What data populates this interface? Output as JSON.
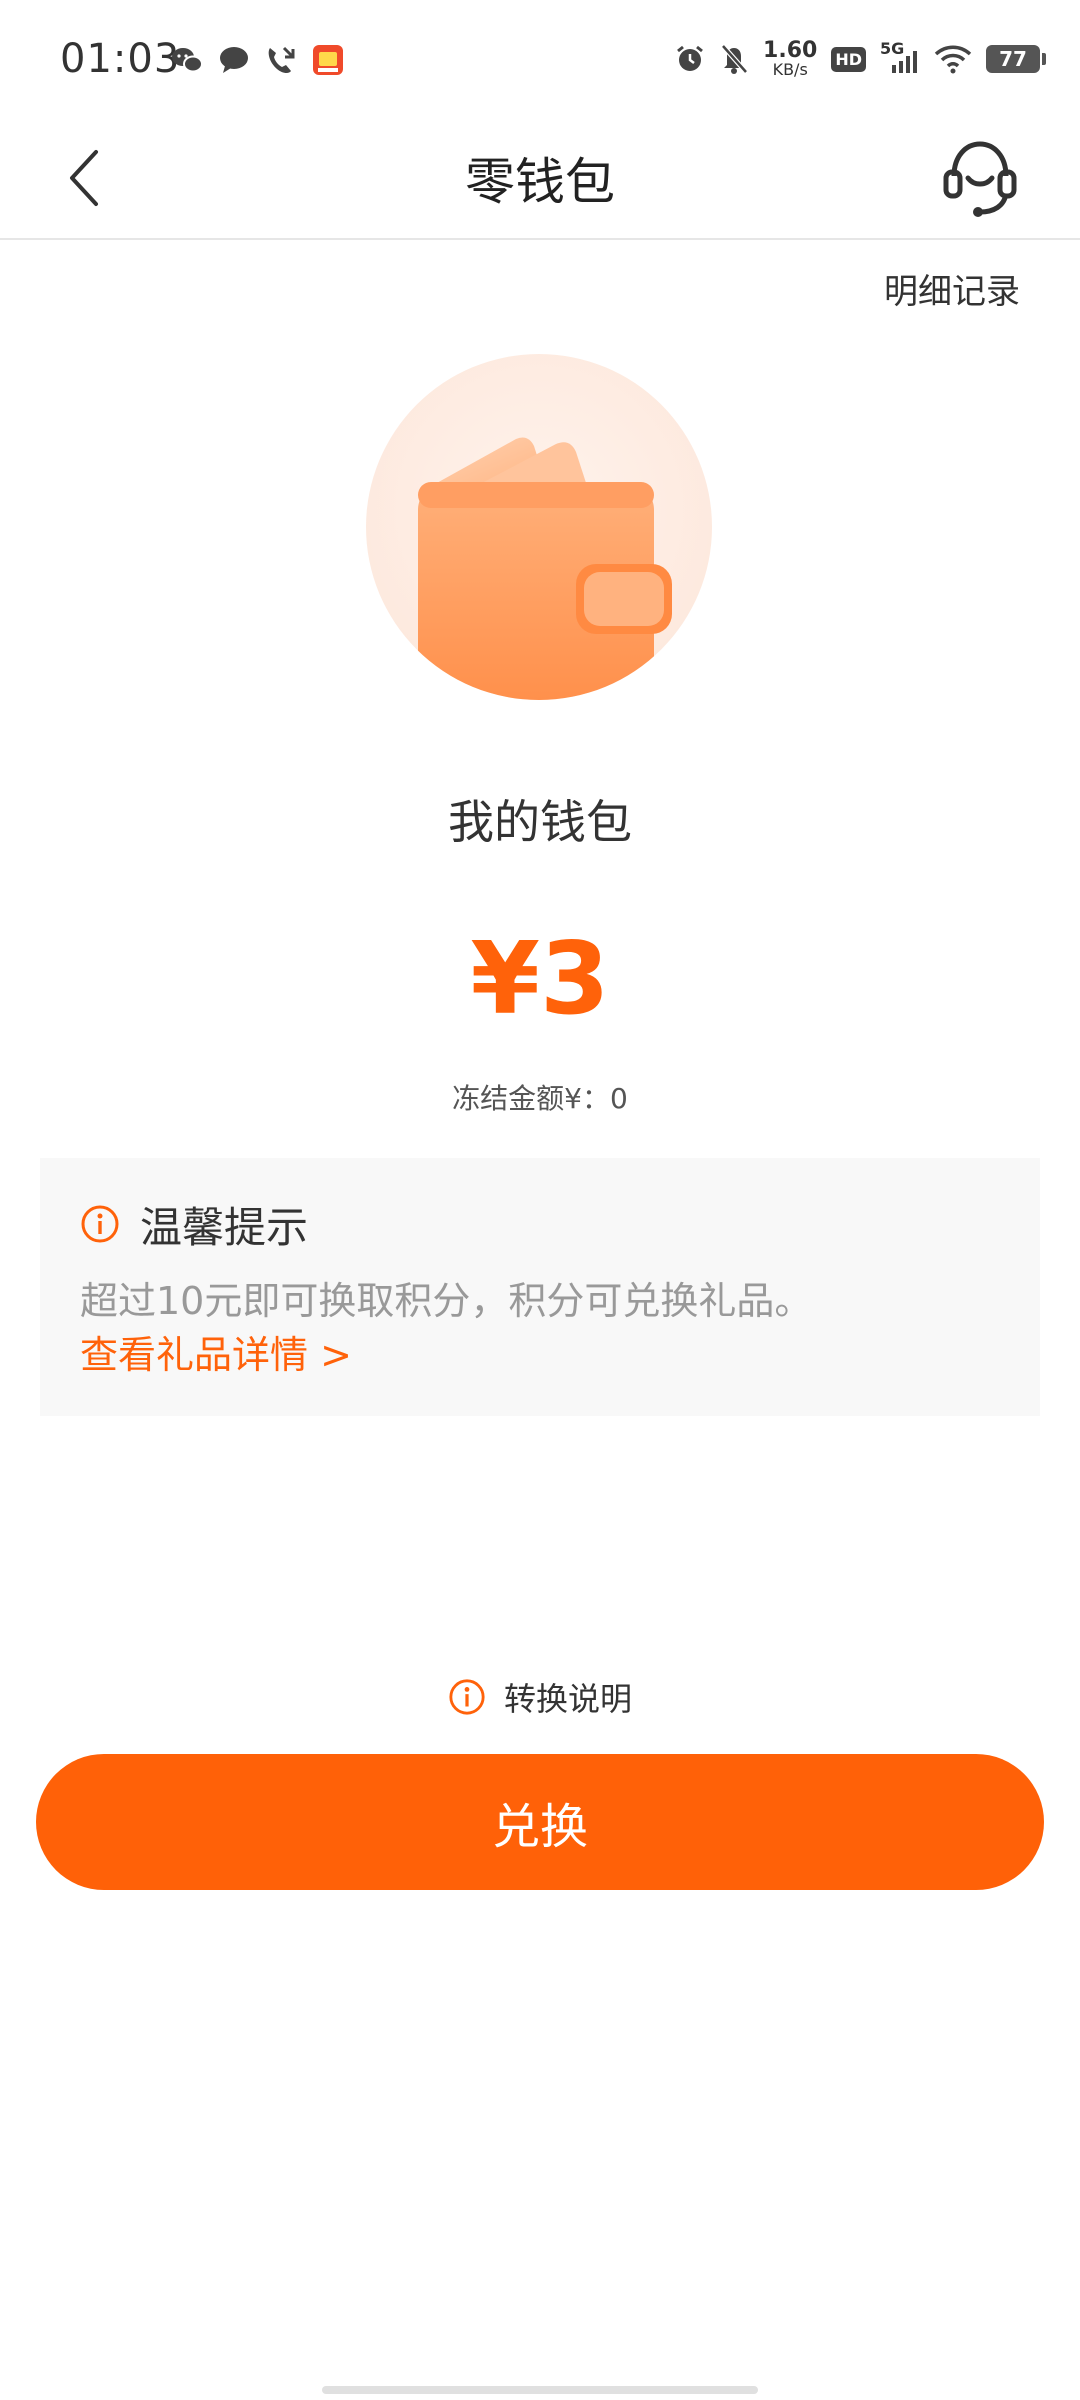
{
  "status_bar": {
    "time": "01:03",
    "net_speed_value": "1.60",
    "net_speed_unit": "KB/s",
    "hd_label": "HD",
    "network": "5G",
    "battery": "77"
  },
  "header": {
    "title": "零钱包"
  },
  "details_link": "明细记录",
  "wallet": {
    "title": "我的钱包",
    "balance": "¥3",
    "frozen_amount": "冻结金额¥：0"
  },
  "tips": {
    "title": "温馨提示",
    "text": "超过10元即可换取积分，积分可兑换礼品。",
    "link": "查看礼品详情 >"
  },
  "convert_info": "转换说明",
  "exchange_button": "兑换",
  "colors": {
    "accent": "#ff620a",
    "button": "#ff6108",
    "card_bg": "#f8f8f8"
  }
}
